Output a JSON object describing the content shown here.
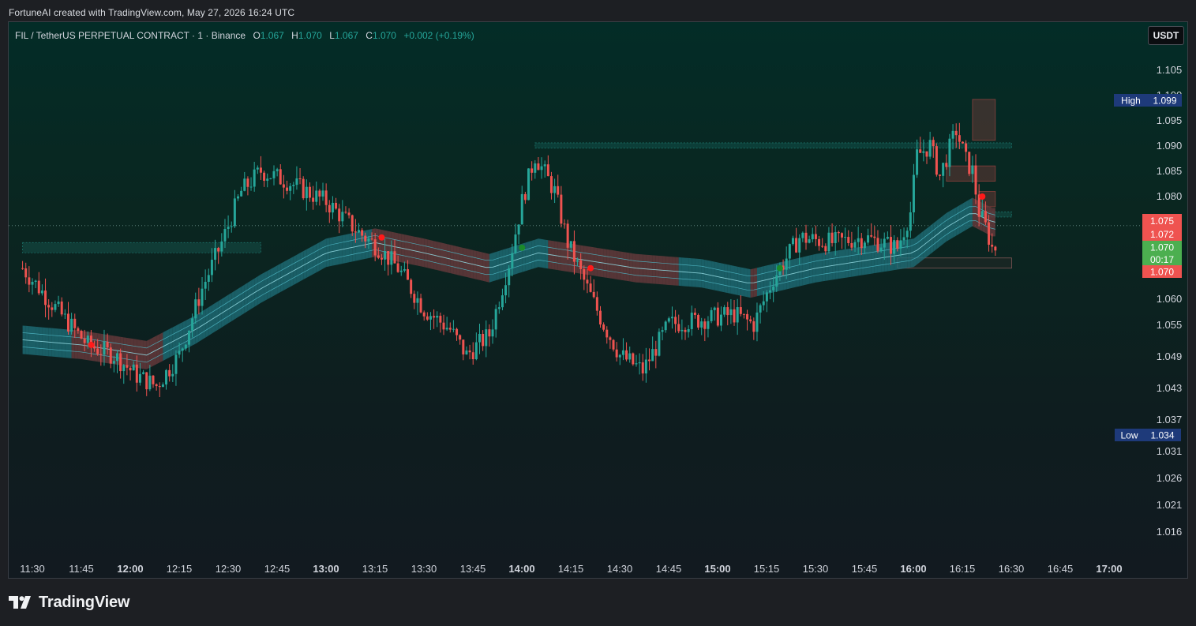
{
  "caption": "FortuneAI created with TradingView.com, May 27, 2026 16:24 UTC",
  "legend": {
    "symbol": "FIL / TetherUS PERPETUAL CONTRACT · 1 · Binance",
    "o_label": "O",
    "o_value": "1.067",
    "h_label": "H",
    "h_value": "1.070",
    "l_label": "L",
    "l_value": "1.067",
    "c_label": "C",
    "c_value": "1.070",
    "change": "+0.002 (+0.19%)"
  },
  "currency_button": "USDT",
  "brand": "TradingView",
  "colors": {
    "up": "#26a69a",
    "down": "#ef5350",
    "band_teal": "#1f6f7a",
    "band_red": "#6b3b3e",
    "high_badge": "#1e3a7a",
    "last_price": "#4caf50",
    "marker_red": "#ff1a1a",
    "marker_green": "#1b8a2a"
  },
  "price_axis": {
    "ticks": [
      "1.105",
      "1.100",
      "1.095",
      "1.090",
      "1.085",
      "1.080",
      "1.060",
      "1.055",
      "1.049",
      "1.043",
      "1.037",
      "1.031",
      "1.026",
      "1.021",
      "1.016"
    ],
    "high_label": "High",
    "high_value": "1.099",
    "low_label": "Low",
    "low_value": "1.034",
    "level_1": "1.075",
    "level_2": "1.072",
    "last_price": "1.070",
    "countdown": "00:17",
    "level_3": "1.070"
  },
  "time_axis": {
    "ticks": [
      {
        "label": "11:30",
        "bold": false
      },
      {
        "label": "11:45",
        "bold": false
      },
      {
        "label": "12:00",
        "bold": true
      },
      {
        "label": "12:15",
        "bold": false
      },
      {
        "label": "12:30",
        "bold": false
      },
      {
        "label": "12:45",
        "bold": false
      },
      {
        "label": "13:00",
        "bold": true
      },
      {
        "label": "13:15",
        "bold": false
      },
      {
        "label": "13:30",
        "bold": false
      },
      {
        "label": "13:45",
        "bold": false
      },
      {
        "label": "14:00",
        "bold": true
      },
      {
        "label": "14:15",
        "bold": false
      },
      {
        "label": "14:30",
        "bold": false
      },
      {
        "label": "14:45",
        "bold": false
      },
      {
        "label": "15:00",
        "bold": true
      },
      {
        "label": "15:15",
        "bold": false
      },
      {
        "label": "15:30",
        "bold": false
      },
      {
        "label": "15:45",
        "bold": false
      },
      {
        "label": "16:00",
        "bold": true
      },
      {
        "label": "16:15",
        "bold": false
      },
      {
        "label": "16:30",
        "bold": false
      },
      {
        "label": "16:45",
        "bold": false
      },
      {
        "label": "17:00",
        "bold": true
      }
    ]
  },
  "chart_data": {
    "type": "candlestick",
    "x_range": [
      "11:27",
      "16:25"
    ],
    "y_range": [
      1.012,
      1.108
    ],
    "price_path": [
      [
        "11:27",
        1.066
      ],
      [
        "11:40",
        1.056
      ],
      [
        "11:47",
        1.051
      ],
      [
        "11:55",
        1.049
      ],
      [
        "12:02",
        1.045
      ],
      [
        "12:08",
        1.043
      ],
      [
        "12:15",
        1.049
      ],
      [
        "12:22",
        1.062
      ],
      [
        "12:28",
        1.071
      ],
      [
        "12:34",
        1.081
      ],
      [
        "12:40",
        1.085
      ],
      [
        "12:48",
        1.083
      ],
      [
        "13:00",
        1.079
      ],
      [
        "13:10",
        1.073
      ],
      [
        "13:16",
        1.07
      ],
      [
        "13:22",
        1.066
      ],
      [
        "13:30",
        1.058
      ],
      [
        "13:38",
        1.054
      ],
      [
        "13:43",
        1.049
      ],
      [
        "13:50",
        1.053
      ],
      [
        "13:56",
        1.067
      ],
      [
        "14:00",
        1.079
      ],
      [
        "14:04",
        1.088
      ],
      [
        "14:10",
        1.081
      ],
      [
        "14:14",
        1.071
      ],
      [
        "14:20",
        1.062
      ],
      [
        "14:25",
        1.055
      ],
      [
        "14:30",
        1.049
      ],
      [
        "14:37",
        1.046
      ],
      [
        "14:45",
        1.055
      ],
      [
        "14:55",
        1.056
      ],
      [
        "15:05",
        1.057
      ],
      [
        "15:11",
        1.055
      ],
      [
        "15:17",
        1.064
      ],
      [
        "15:25",
        1.072
      ],
      [
        "15:35",
        1.071
      ],
      [
        "15:45",
        1.072
      ],
      [
        "15:55",
        1.07
      ],
      [
        "15:59",
        1.077
      ],
      [
        "16:01",
        1.088
      ],
      [
        "16:05",
        1.09
      ],
      [
        "16:08",
        1.084
      ],
      [
        "16:13",
        1.093
      ],
      [
        "16:16",
        1.087
      ],
      [
        "16:18",
        1.085
      ],
      [
        "16:20",
        1.077
      ],
      [
        "16:22",
        1.074
      ],
      [
        "16:24",
        1.07
      ]
    ],
    "ma_band": [
      [
        "11:27",
        1.052
      ],
      [
        "11:45",
        1.051
      ],
      [
        "12:05",
        1.049
      ],
      [
        "12:20",
        1.054
      ],
      [
        "12:40",
        1.062
      ],
      [
        "13:00",
        1.069
      ],
      [
        "13:15",
        1.071
      ],
      [
        "13:30",
        1.069
      ],
      [
        "13:50",
        1.066
      ],
      [
        "14:05",
        1.069
      ],
      [
        "14:15",
        1.068
      ],
      [
        "14:35",
        1.066
      ],
      [
        "14:55",
        1.065
      ],
      [
        "15:10",
        1.063
      ],
      [
        "15:30",
        1.066
      ],
      [
        "15:50",
        1.068
      ],
      [
        "16:00",
        1.069
      ],
      [
        "16:10",
        1.074
      ],
      [
        "16:18",
        1.077
      ],
      [
        "16:24",
        1.075
      ]
    ],
    "band_state": [
      [
        "11:27",
        "teal"
      ],
      [
        "11:42",
        "red"
      ],
      [
        "12:10",
        "teal"
      ],
      [
        "13:14",
        "red"
      ],
      [
        "13:50",
        "teal"
      ],
      [
        "14:08",
        "red"
      ],
      [
        "14:48",
        "teal"
      ],
      [
        "15:10",
        "red"
      ],
      [
        "15:12",
        "teal"
      ],
      [
        "16:18",
        "red"
      ]
    ],
    "signals": [
      {
        "t": "11:48",
        "p": 1.051,
        "kind": "sell"
      },
      {
        "t": "13:17",
        "p": 1.072,
        "kind": "sell"
      },
      {
        "t": "14:00",
        "p": 1.07,
        "kind": "buy"
      },
      {
        "t": "14:21",
        "p": 1.066,
        "kind": "sell"
      },
      {
        "t": "15:19",
        "p": 1.066,
        "kind": "buy"
      },
      {
        "t": "16:21",
        "p": 1.08,
        "kind": "sell"
      }
    ],
    "zones": [
      {
        "t1": "11:27",
        "t2": "12:40",
        "p1": 1.071,
        "p2": 1.069,
        "kind": "green"
      },
      {
        "t1": "14:04",
        "t2": "16:30",
        "p1": 1.0905,
        "p2": 1.0895,
        "kind": "green"
      },
      {
        "t1": "16:18",
        "t2": "16:25",
        "p1": 1.099,
        "p2": 1.091,
        "kind": "red"
      },
      {
        "t1": "16:10",
        "t2": "16:25",
        "p1": 1.086,
        "p2": 1.083,
        "kind": "red"
      },
      {
        "t1": "16:20",
        "t2": "16:25",
        "p1": 1.081,
        "p2": 1.078,
        "kind": "red"
      },
      {
        "t1": "16:20",
        "t2": "16:30",
        "p1": 1.077,
        "p2": 1.076,
        "kind": "green"
      },
      {
        "t1": "15:55",
        "t2": "16:30",
        "p1": 1.068,
        "p2": 1.066,
        "kind": "red_outline"
      }
    ],
    "high": 1.099,
    "low": 1.034,
    "last": 1.07
  }
}
